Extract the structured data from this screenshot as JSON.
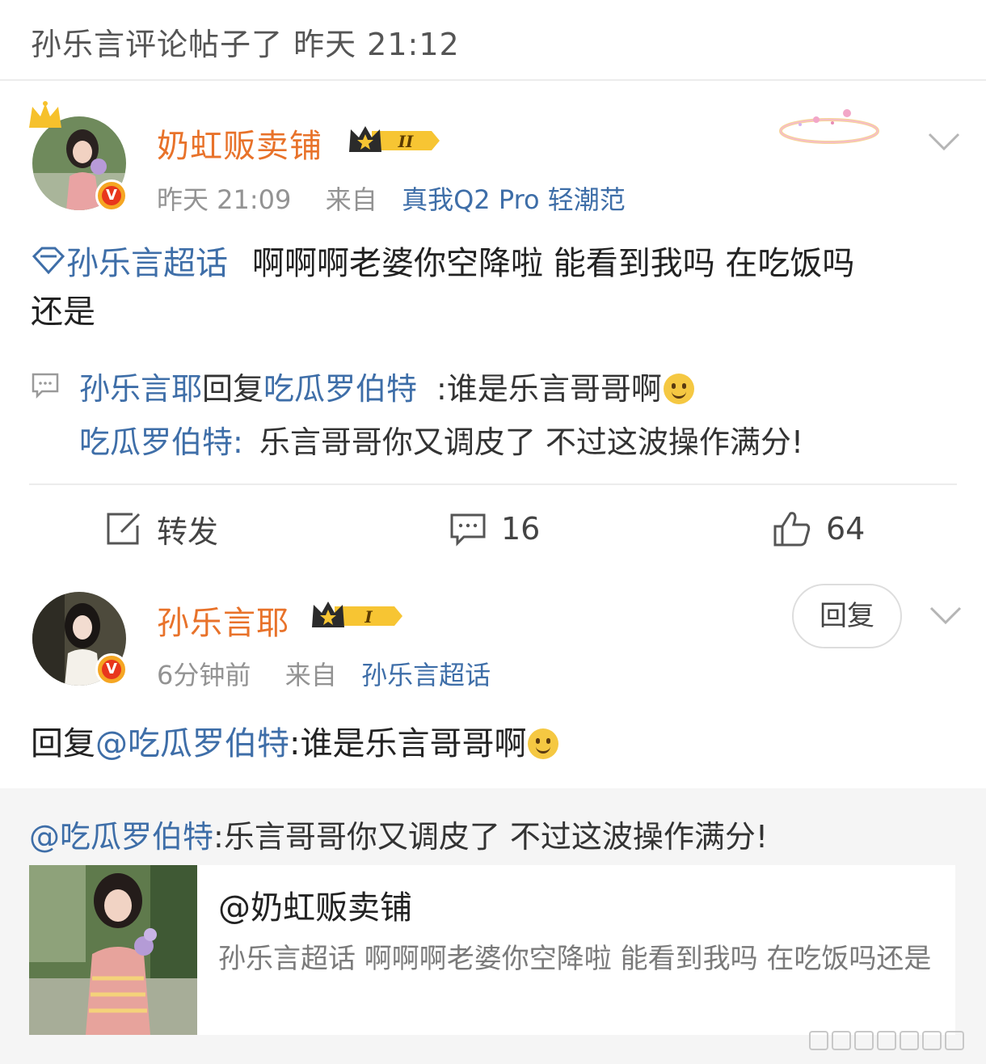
{
  "header": {
    "text": "孙乐言评论帖子了 昨天 21:12"
  },
  "post": {
    "username": "奶虹贩卖铺",
    "level": "II",
    "time": "昨天 21:09",
    "source_prefix": "来自",
    "source": "真我Q2 Pro 轻潮范",
    "topic": "孙乐言超话",
    "content_line1": "啊啊啊老婆你空降啦 能看到我吗 在吃饭吗",
    "content_line2": "还是",
    "comments": [
      {
        "user": "孙乐言耶",
        "reply_word": "回复",
        "target": "吃瓜罗伯特",
        "text": ":谁是乐言哥哥啊"
      },
      {
        "user": "吃瓜罗伯特",
        "separator": ":",
        "text": "乐言哥哥你又调皮了 不过这波操作满分!"
      }
    ],
    "actions": {
      "repost": "转发",
      "comments": "16",
      "likes": "64"
    }
  },
  "reply": {
    "username": "孙乐言耶",
    "level": "I",
    "time": "6分钟前",
    "source_prefix": "来自",
    "source": "孙乐言超话",
    "reply_button": "回复",
    "content_prefix": "回复",
    "mention": "@吃瓜罗伯特",
    "content": ":谁是乐言哥哥啊"
  },
  "quote": {
    "mention": "@吃瓜罗伯特",
    "text": ":乐言哥哥你又调皮了 不过这波操作满分!",
    "card_title": "@奶虹贩卖铺",
    "card_desc": "孙乐言超话 啊啊啊老婆你空降啦 能看到我吗 在吃饭吗还是"
  },
  "colors": {
    "link": "#3e6ea8",
    "username": "#e8722a",
    "meta": "#939393"
  }
}
